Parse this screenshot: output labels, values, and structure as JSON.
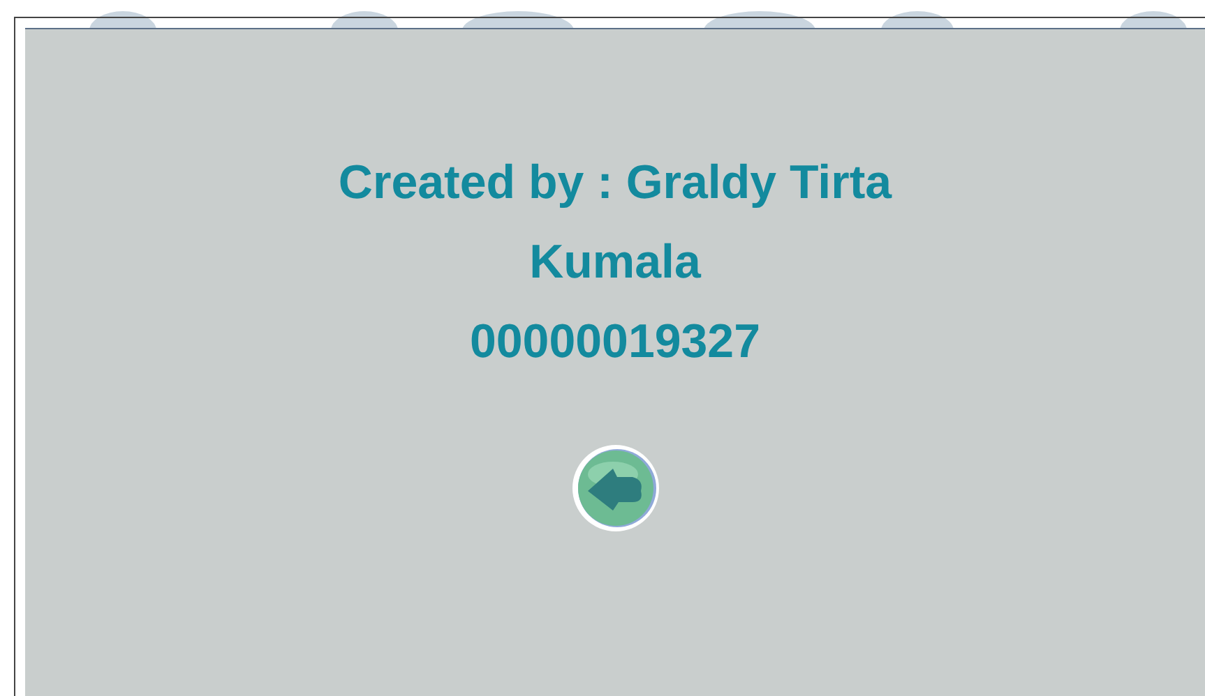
{
  "credit": {
    "text": "Created by : Graldy Tirta Kumala",
    "id_number": "00000019327"
  },
  "back_button": {
    "kind": "back"
  }
}
